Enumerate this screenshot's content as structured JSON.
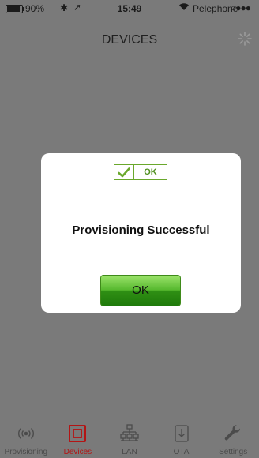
{
  "status_bar": {
    "battery": "90%",
    "time": "15:49",
    "carrier": "Pelephone",
    "signal": "○●●●"
  },
  "nav": {
    "title": "DEVICES"
  },
  "dialog": {
    "badge_label": "OK",
    "message": "Provisioning Successful",
    "ok_button": "OK"
  },
  "tabs": [
    {
      "label": "Provisioning",
      "icon": "radio-signal-icon",
      "active": false
    },
    {
      "label": "Devices",
      "icon": "device-chip-icon",
      "active": true
    },
    {
      "label": "LAN",
      "icon": "network-icon",
      "active": false
    },
    {
      "label": "OTA",
      "icon": "download-icon",
      "active": false
    },
    {
      "label": "Settings",
      "icon": "wrench-icon",
      "active": false
    }
  ],
  "colors": {
    "active_tab": "#b31515",
    "overlay": "#7a7a7a",
    "ok_green": "#56b82e"
  }
}
